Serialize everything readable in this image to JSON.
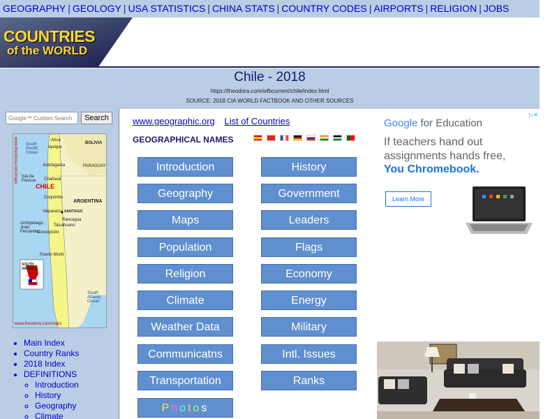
{
  "topnav": {
    "items": [
      "GEOGRAPHY",
      "GEOLOGY",
      "USA STATISTICS",
      "CHINA STATS",
      "COUNTRY CODES",
      "AIRPORTS",
      "RELIGION",
      "JOBS"
    ],
    "separator": "|"
  },
  "logo": {
    "line1": "COUNTRIES",
    "line2": "of the WORLD"
  },
  "title": {
    "heading": "Chile - 2018",
    "url": "https://theodora.com/wfbcurrent/chile/index.html",
    "source": "SOURCE: 2018 CIA WORLD FACTBOOK AND OTHER SOURCES"
  },
  "search": {
    "placeholder": "Google™ Custom Search",
    "button_label": "Search"
  },
  "map": {
    "labels": {
      "bolivia": "BOLIVIA",
      "paraguay": "PARAGUAY",
      "argentina": "ARGENTINA",
      "chile": "CHILE",
      "santiago": "SANTIAGO",
      "pacific": "South Pacific Ocean",
      "atlantic": "South Atlantic Ocean",
      "arica": "Arica",
      "iquique": "Iquique",
      "antofagasta": "Antofagasta",
      "chanaral": "Chañaral",
      "coquimbo": "Coquimbo",
      "valparaiso": "Valparaíso",
      "concepcion": "Concepción",
      "talcahuano": "Talcahuano",
      "puertomontt": "Puerto Montt",
      "rancagua": "Rancagua",
      "isladepascua": "Isla de Pascua",
      "juanfernandez": "Archipiélago Juan Fernández",
      "southamerica": "SOUTH AMERICA",
      "footer": "www.theodora.com/maps",
      "side": "www.theodora.com/maps"
    }
  },
  "leftlinks": {
    "main": [
      "Main Index",
      "Country Ranks",
      "2018 Index",
      "DEFINITIONS"
    ],
    "sub": [
      "Introduction",
      "History",
      "Geography",
      "Climate"
    ]
  },
  "center": {
    "link1": "www.geographic.org",
    "link2": "List of Countries",
    "geonames": "GEOGRAPHICAL NAMES",
    "flags": [
      "spain-flag",
      "china-flag",
      "france-flag",
      "germany-flag",
      "russia-flag",
      "india-flag",
      "arabic-flag",
      "portugal-flag"
    ],
    "buttons_left": [
      "Introduction",
      "Geography",
      "Maps",
      "Population",
      "Religion",
      "Climate",
      "Weather Data",
      "Communicatns",
      "Transportation"
    ],
    "buttons_right": [
      "History",
      "Government",
      "Leaders",
      "Flags",
      "Economy",
      "Energy",
      "Military",
      "Intl. Issues",
      "Ranks"
    ],
    "photos": "Photos",
    "photos_colors": [
      "#ffeb3b",
      "#ff66cc",
      "#66ffcc",
      "#ffcc66",
      "#99ff66",
      "#ffffff"
    ]
  },
  "ads": {
    "ad1": {
      "brand_google": "Google",
      "brand_rest": " for Education",
      "headline": "If teachers hand out assignments hands free,",
      "headline2": "You Chromebook.",
      "button": "Learn More"
    }
  },
  "colors": {
    "band": "#b9cde5",
    "button": "#5f8fcf",
    "link": "#0000cc"
  }
}
